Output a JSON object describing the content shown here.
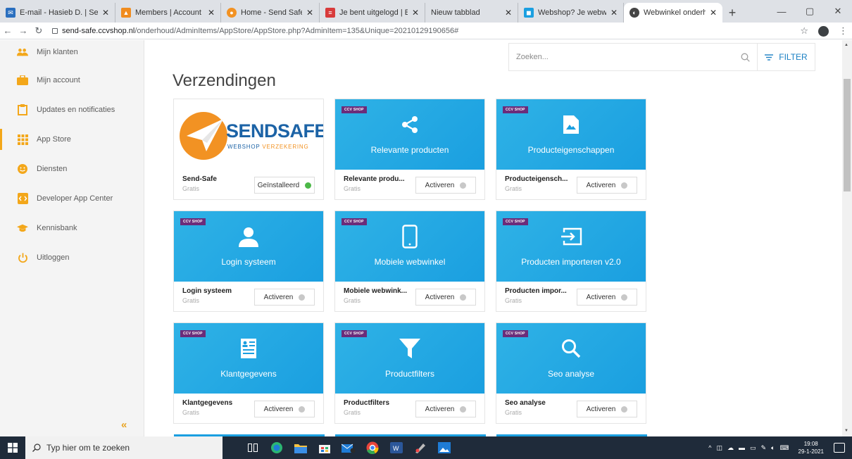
{
  "browser": {
    "tabs": [
      {
        "title": "E-mail - Hasieb D. | Sen",
        "favicon": "outlook-icon",
        "color": "#2a6fbf"
      },
      {
        "title": "Members | Account | Cl",
        "favicon": "members-icon",
        "color": "#f08c1f"
      },
      {
        "title": "Home - Send Safe",
        "favicon": "sendsafe-icon",
        "color": "#f29223"
      },
      {
        "title": "Je bent uitgelogd | Ein",
        "favicon": "document-icon",
        "color": "#d83b3b"
      },
      {
        "title": "Nieuw tabblad",
        "favicon": "",
        "color": ""
      },
      {
        "title": "Webshop? Je webwinke",
        "favicon": "webshop-icon",
        "color": "#1a9fe0"
      },
      {
        "title": "Webwinkel onderhoud",
        "favicon": "globe-icon",
        "color": "#444444"
      }
    ],
    "url_host": "send-safe.ccvshop.nl",
    "url_path": "/onderhoud/AdminItems/AppStore/AppStore.php?AdminItem=135&Unique=20210129190656#"
  },
  "sidebar": {
    "items": [
      {
        "label": "Mijn klanten",
        "icon": "users-icon"
      },
      {
        "label": "Mijn account",
        "icon": "briefcase-icon"
      },
      {
        "label": "Updates en notificaties",
        "icon": "clipboard-icon"
      },
      {
        "label": "App Store",
        "icon": "grid-icon"
      },
      {
        "label": "Diensten",
        "icon": "smiley-icon"
      },
      {
        "label": "Developer App Center",
        "icon": "code-icon"
      },
      {
        "label": "Kennisbank",
        "icon": "graduation-cap-icon"
      },
      {
        "label": "Uitloggen",
        "icon": "power-icon"
      }
    ],
    "collapse_label": "«"
  },
  "main": {
    "search_placeholder": "Zoeken...",
    "filter_label": "FILTER",
    "title": "Verzendingen",
    "badge": "CCV SHOP",
    "cards": [
      {
        "caption": "",
        "name": "Send-Safe",
        "price": "Gratis",
        "button": "Geïnstalleerd",
        "installed": true,
        "icon": "sendsafe-logo"
      },
      {
        "caption": "Relevante producten",
        "name": "Relevante produ...",
        "price": "Gratis",
        "button": "Activeren",
        "installed": false,
        "icon": "share-icon"
      },
      {
        "caption": "Producteigenschappen",
        "name": "Producteigensch...",
        "price": "Gratis",
        "button": "Activeren",
        "installed": false,
        "icon": "image-file-icon"
      },
      {
        "caption": "Login systeem",
        "name": "Login systeem",
        "price": "Gratis",
        "button": "Activeren",
        "installed": false,
        "icon": "user-icon"
      },
      {
        "caption": "Mobiele webwinkel",
        "name": "Mobiele webwink...",
        "price": "Gratis",
        "button": "Activeren",
        "installed": false,
        "icon": "mobile-icon"
      },
      {
        "caption": "Producten importeren v2.0",
        "name": "Producten impor...",
        "price": "Gratis",
        "button": "Activeren",
        "installed": false,
        "icon": "import-icon"
      },
      {
        "caption": "Klantgegevens",
        "name": "Klantgegevens",
        "price": "Gratis",
        "button": "Activeren",
        "installed": false,
        "icon": "contact-card-icon"
      },
      {
        "caption": "Productfilters",
        "name": "Productfilters",
        "price": "Gratis",
        "button": "Activeren",
        "installed": false,
        "icon": "funnel-icon"
      },
      {
        "caption": "Seo analyse",
        "name": "Seo analyse",
        "price": "Gratis",
        "button": "Activeren",
        "installed": false,
        "icon": "magnifier-icon"
      }
    ],
    "sendsafe_logo": {
      "word": "SENDSAFE",
      "sub_a": "WEBSHOP ",
      "sub_b": "VERZEKERING"
    }
  },
  "taskbar": {
    "search_placeholder": "Typ hier om te zoeken",
    "time": "19:08",
    "date": "29-1-2021"
  },
  "colors": {
    "accent_orange": "#f3a71a",
    "card_blue": "#1a9fe0",
    "badge_purple": "#6b2c7a",
    "filter_blue": "#1b80c4",
    "installed_green": "#4cb848"
  }
}
